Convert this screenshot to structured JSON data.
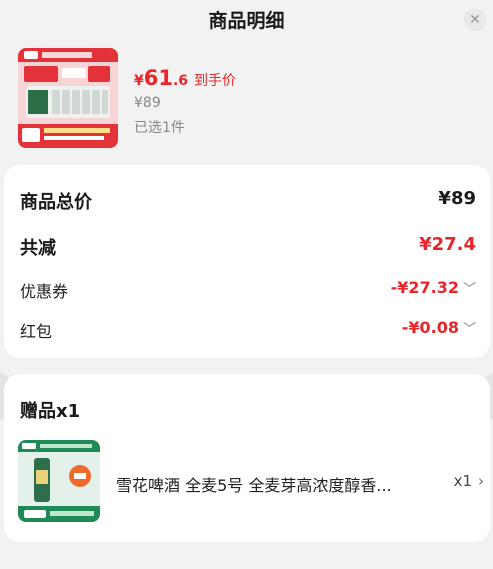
{
  "header": {
    "title": "商品明细",
    "close_icon": "close-icon"
  },
  "product": {
    "currency": "¥",
    "final_price_int": "61",
    "final_price_dec": ".6",
    "final_price_label": "到手价",
    "original_price": "¥89",
    "selected_text": "已选1件"
  },
  "price_detail": {
    "total_label": "商品总价",
    "total_value": "¥89",
    "reduce_label": "共减",
    "reduce_value": "¥27.4",
    "coupon_label": "优惠券",
    "coupon_value": "-¥27.32",
    "redpack_label": "红包",
    "redpack_value": "-¥0.08"
  },
  "gift": {
    "title": "赠品x1",
    "item_name": "雪花啤酒 全麦5号 全麦芽高浓度醇香...",
    "item_qty": "x1"
  },
  "colors": {
    "accent_red": "#e8262a",
    "card_bg": "#ffffff",
    "page_bg": "#f2f2f2"
  }
}
